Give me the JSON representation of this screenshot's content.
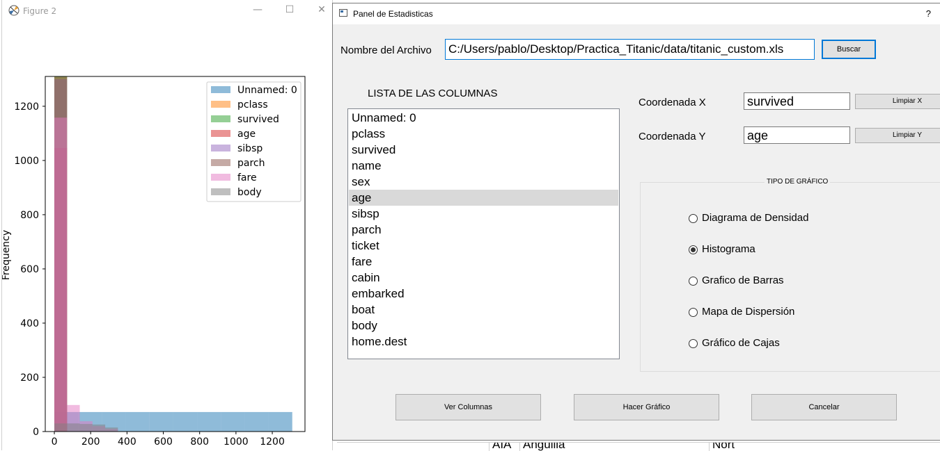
{
  "figure_window": {
    "title": "Figure 2",
    "minimize": "—",
    "maximize": "☐",
    "close": "✕"
  },
  "chart_data": {
    "type": "bar",
    "histtype": "overlaid-histogram",
    "ylabel": "Frequency",
    "xlim": [
      -50,
      1380
    ],
    "ylim": [
      0,
      1310
    ],
    "xticks": [
      0,
      200,
      400,
      600,
      800,
      1000,
      1200
    ],
    "yticks": [
      0,
      200,
      400,
      600,
      800,
      1000,
      1200
    ],
    "legend_position": "upper right",
    "series": [
      {
        "name": "Unnamed: 0",
        "color": "#1f77b4",
        "bins": [
          [
            0,
            131,
            72
          ],
          [
            131,
            262,
            72
          ],
          [
            262,
            393,
            72
          ],
          [
            393,
            524,
            72
          ],
          [
            524,
            655,
            72
          ],
          [
            655,
            786,
            72
          ],
          [
            786,
            917,
            72
          ],
          [
            917,
            1048,
            72
          ],
          [
            1048,
            1179,
            72
          ],
          [
            1179,
            1310,
            72
          ]
        ]
      },
      {
        "name": "pclass",
        "color": "#ff7f0e",
        "bins": [
          [
            0,
            70,
            1309
          ]
        ]
      },
      {
        "name": "survived",
        "color": "#2ca02c",
        "bins": [
          [
            0,
            70,
            1309
          ]
        ]
      },
      {
        "name": "age",
        "color": "#d62728",
        "bins": [
          [
            0,
            70,
            1046
          ]
        ]
      },
      {
        "name": "sibsp",
        "color": "#9467bd",
        "bins": [
          [
            0,
            70,
            1300
          ]
        ]
      },
      {
        "name": "parch",
        "color": "#8c564b",
        "bins": [
          [
            0,
            70,
            1308
          ]
        ]
      },
      {
        "name": "fare",
        "color": "#e377c2",
        "bins": [
          [
            0,
            70,
            1158
          ],
          [
            70,
            140,
            98
          ],
          [
            140,
            210,
            38
          ],
          [
            210,
            280,
            20
          ],
          [
            280,
            350,
            10
          ],
          [
            350,
            420,
            1
          ]
        ]
      },
      {
        "name": "body",
        "color": "#7f7f7f",
        "bins": [
          [
            0,
            70,
            30
          ],
          [
            70,
            140,
            30
          ],
          [
            140,
            210,
            28
          ],
          [
            210,
            280,
            26
          ],
          [
            280,
            350,
            15
          ],
          [
            350,
            420,
            1
          ]
        ]
      }
    ]
  },
  "dialog": {
    "title": "Panel de Estadisticas",
    "help": "?",
    "file_label": "Nombre del Archivo",
    "file_value": "C:/Users/pablo/Desktop/Practica_Titanic/data/titanic_custom.xls",
    "browse_label": "Buscar",
    "list_header": "LISTA DE LAS COLUMNAS",
    "columns": [
      "Unnamed: 0",
      "pclass",
      "survived",
      "name",
      "sex",
      "age",
      "sibsp",
      "parch",
      "ticket",
      "fare",
      "cabin",
      "embarked",
      "boat",
      "body",
      "home.dest"
    ],
    "selected_column": "age",
    "x_label": "Coordenada X",
    "x_value": "survived",
    "clear_x": "Limpiar X",
    "y_label": "Coordenada Y",
    "y_value": "age",
    "clear_y": "Limpiar Y",
    "chart_type_title": "TIPO DE GRÁFICO",
    "chart_types": [
      {
        "label": "Diagrama de Densidad",
        "checked": false
      },
      {
        "label": "Histograma",
        "checked": true
      },
      {
        "label": "Grafico de Barras",
        "checked": false
      },
      {
        "label": "Mapa de Dispersión",
        "checked": false
      },
      {
        "label": "Gráfico de Cajas",
        "checked": false
      }
    ],
    "buttons": {
      "view_columns": "Ver Columnas",
      "make_chart": "Hacer Gráfico",
      "cancel": "Cancelar"
    }
  },
  "background_table": {
    "cells": [
      "AIA",
      "Anguilla",
      "Nort"
    ]
  }
}
